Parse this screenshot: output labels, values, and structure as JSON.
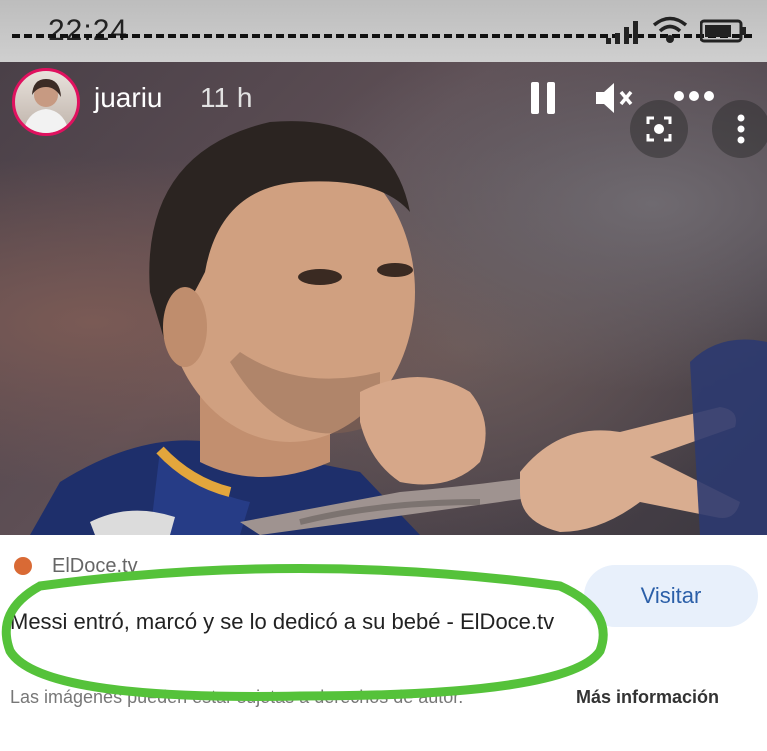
{
  "status_bar": {
    "time": "22:24"
  },
  "story": {
    "username": "juariu",
    "time_ago": "11 h",
    "icons": [
      "pause-icon",
      "mute-icon",
      "more-icon",
      "lens-icon",
      "kebab-icon"
    ]
  },
  "link_card": {
    "source": "ElDoce.tv",
    "headline": "Messi entró, marcó y se lo dedicó a su bebé - ElDoce.tv",
    "visit_label": "Visitar",
    "footer_text": "Las imágenes pueden estar sujetas a derechos de autor.",
    "more_info_label": "Más información"
  },
  "colors": {
    "highlight_ring": "#55c23a",
    "visit_button_bg": "#e8f0fb",
    "visit_button_text": "#2b5fa8"
  }
}
